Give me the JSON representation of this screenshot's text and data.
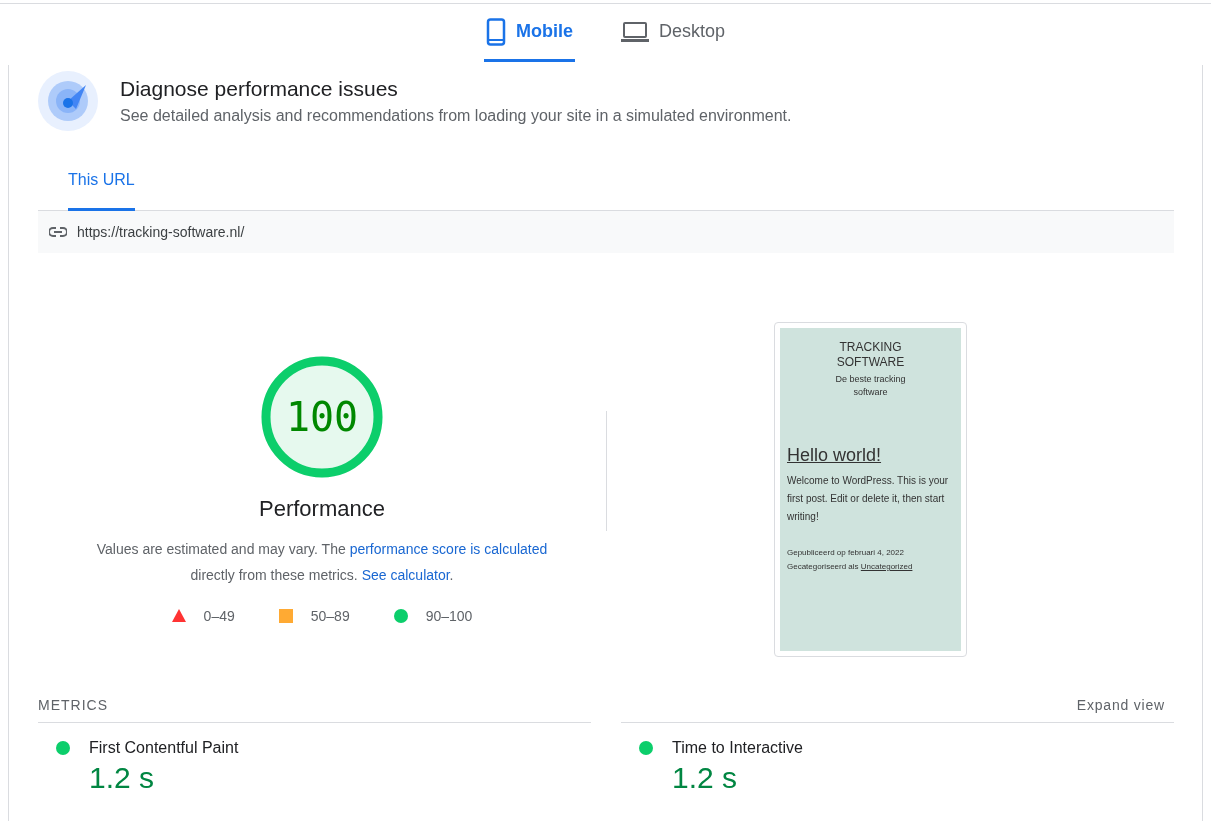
{
  "device_tabs": [
    {
      "label": "Mobile",
      "kind": "phone",
      "selected": true
    },
    {
      "label": "Desktop",
      "kind": "laptop",
      "selected": false
    }
  ],
  "header": {
    "title": "Diagnose performance issues",
    "subtitle": "See detailed analysis and recommendations from loading your site in a simulated environment."
  },
  "url_tabs": [
    {
      "label": "This URL",
      "selected": true
    }
  ],
  "url": "https://tracking-software.nl/",
  "score": {
    "value": "100",
    "level": 1,
    "label": "Performance",
    "note_before": "Values are estimated and may vary. The ",
    "note_link": "performance score is calculated",
    "note_middle": " directly from these metrics. ",
    "note_link2": "See calculator",
    "note_after": "."
  },
  "legend": [
    {
      "kind": "triangle",
      "color": "#ff3333",
      "label": "0–49"
    },
    {
      "kind": "square",
      "color": "#ffaa33",
      "label": "50–89"
    },
    {
      "kind": "circle",
      "color": "#0cce6b",
      "label": "90–100"
    }
  ],
  "preview": {
    "site_title": "TRACKING SOFTWARE",
    "tagline": "De beste tracking software",
    "post_title": "Hello world!",
    "post_body": "Welcome to WordPress. This is your first post. Edit or delete it, then start writing!",
    "published": "Gepubliceerd op februari 4, 2022",
    "category_prefix": "Gecategoriseerd als ",
    "category": "Uncategorized"
  },
  "metrics_heading": "METRICS",
  "expand_label": "Expand view",
  "metrics": [
    {
      "name": "First Contentful Paint",
      "value": "1.2 s",
      "color": "#0cce6b"
    },
    {
      "name": "Time to Interactive",
      "value": "1.2 s",
      "color": "#0cce6b"
    }
  ]
}
